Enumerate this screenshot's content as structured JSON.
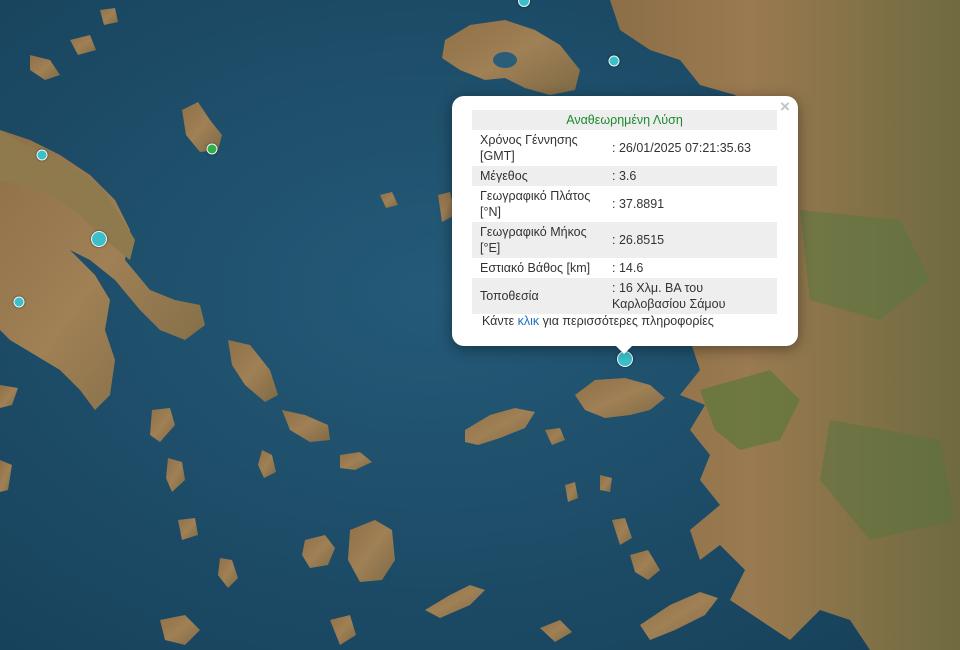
{
  "popup": {
    "title": "Αναθεωρημένη Λύση",
    "rows": [
      {
        "label": "Χρόνος Γέννησης [GMT]",
        "value": ": 26/01/2025 07:21:35.63"
      },
      {
        "label": "Μέγεθος",
        "value": ": 3.6"
      },
      {
        "label": "Γεωγραφικό Πλάτος [°N]",
        "value": ": 37.8891"
      },
      {
        "label": "Γεωγραφικό Μήκος [°E]",
        "value": ": 26.8515"
      },
      {
        "label": "Εστιακό Βάθος [km]",
        "value": ": 14.6"
      },
      {
        "label": "Τοποθεσία",
        "value": ": 16 Χλμ. ΒΑ του Καρλοβασίου Σάμου"
      }
    ],
    "footer_before": "Κάντε ",
    "footer_link": "κλικ",
    "footer_after": " για περισσότερες πληροφορίες",
    "close_symbol": "×"
  },
  "colors": {
    "sea": "#1d4e6b",
    "land_dry": "#9b7b52",
    "land_green": "#5e7a3c",
    "marker": "#3dbfc9",
    "marker_alt": "#2fae4a",
    "title_green": "#1d8a2e",
    "link_blue": "#1b6fc2"
  },
  "icons": {
    "close": "close-icon",
    "marker": "earthquake-marker-icon"
  }
}
